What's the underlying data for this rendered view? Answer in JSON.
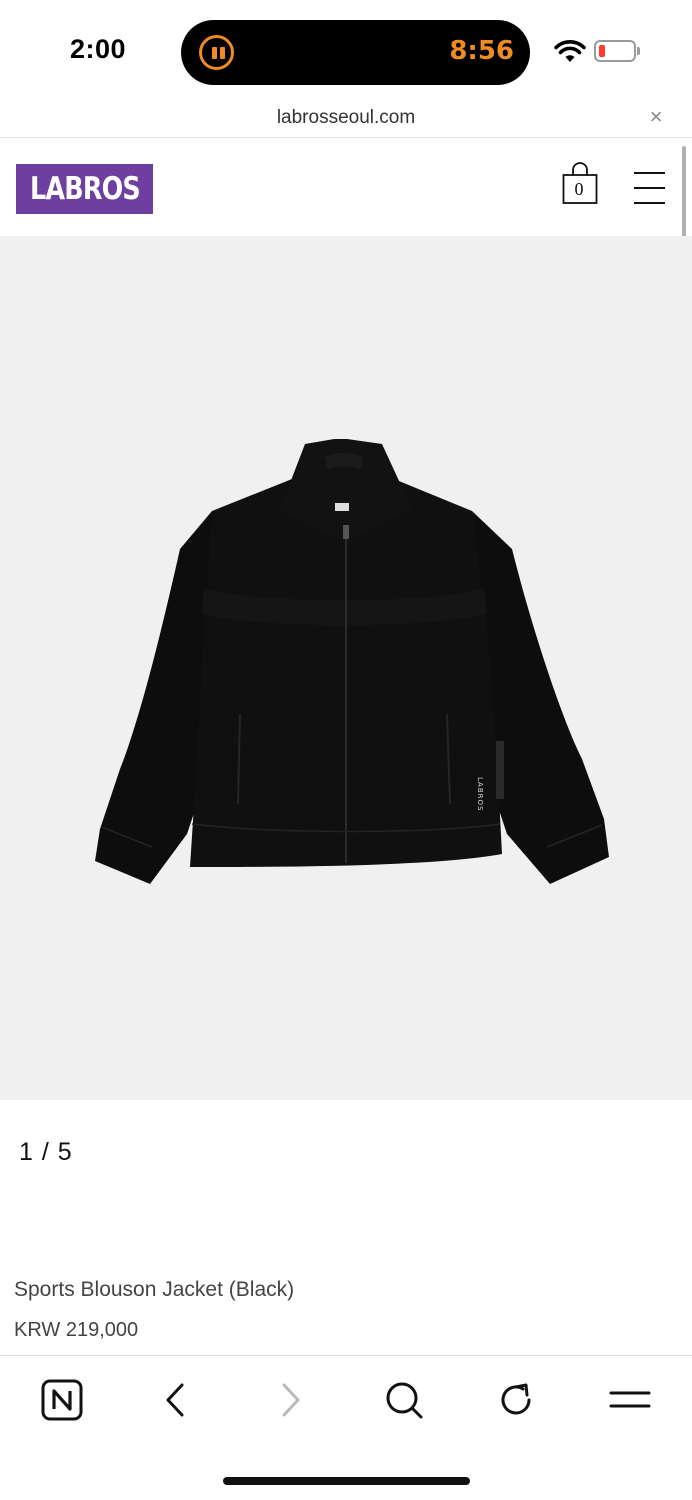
{
  "status_bar": {
    "time": "2:00",
    "activity_timer": "8:56",
    "activity_color": "#f08a24",
    "battery_color": "#ff3b30"
  },
  "browser": {
    "url": "labrosseoul.com",
    "close_icon": "close-icon"
  },
  "header": {
    "logo_text": "LABROS",
    "logo_color": "#6c3fa0",
    "cart_count": "0"
  },
  "product": {
    "image_label": "LABROS",
    "slide_current": "1",
    "slide_separator": "/",
    "slide_total": "5",
    "name": "Sports Blouson Jacket (Black)",
    "price": "KRW 219,000"
  },
  "toolbar": {
    "icons": [
      "naver-home-icon",
      "back-icon",
      "forward-icon",
      "search-icon",
      "reload-icon",
      "menu-icon"
    ]
  }
}
